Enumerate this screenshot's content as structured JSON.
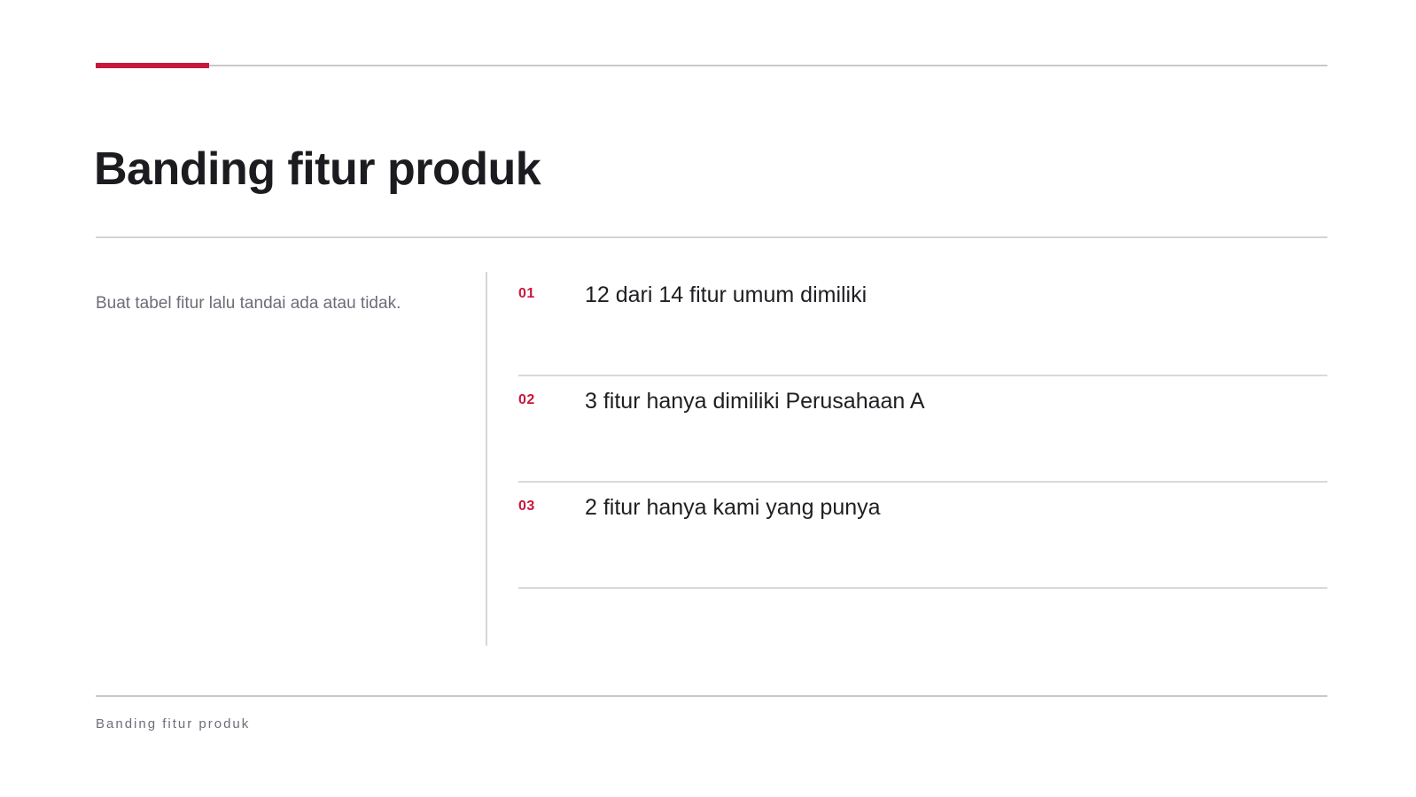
{
  "slide": {
    "title": "Banding fitur produk",
    "note": "Buat tabel fitur lalu tandai ada atau tidak.",
    "items": [
      {
        "number": "01",
        "text": "12 dari 14 fitur umum dimiliki"
      },
      {
        "number": "02",
        "text": "3 fitur hanya dimiliki Perusahaan A"
      },
      {
        "number": "03",
        "text": "2 fitur hanya kami yang punya"
      }
    ],
    "footer": "Banding fitur produk"
  },
  "colors": {
    "accent": "#c8163d",
    "text": "#1f1f23",
    "muted": "#6d6d78",
    "rule": "#c9c9cc"
  }
}
